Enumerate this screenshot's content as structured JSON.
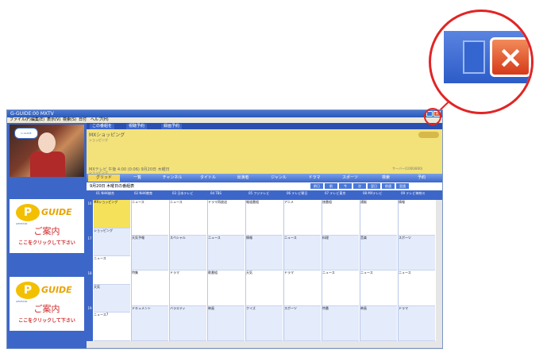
{
  "window": {
    "title": "G-GUIDE:00   MXTV",
    "close_glyph": "×"
  },
  "menu": {
    "items": [
      "ファイル(F)",
      "編集(E)",
      "表示(V)",
      "検索(S)",
      "日付",
      "ヘルプ(H)"
    ]
  },
  "top_tabs": [
    "この番組を",
    "視聴予約",
    "録画予約"
  ],
  "program_info": {
    "title": "MXショッピング",
    "subtitle": "ショッピング",
    "time": "MXテレビ 午後 4:00 (0:06)  9月20日 木曜日",
    "right_text": "サーバー(1000/800)",
    "channel": "ショッピング"
  },
  "toolbar": {
    "buttons": [
      "グリッド",
      "一覧",
      "チャンネル",
      "タイトル",
      "出演者",
      "ジャンル",
      "ドラマ",
      "スポーツ",
      "検索",
      "予約"
    ],
    "active_index": 0
  },
  "date_bar": {
    "text": "9月20日 木曜日の番組表",
    "buttons": [
      "前日",
      "前",
      "今",
      "次",
      "翌日",
      "前週",
      "翌週"
    ]
  },
  "channels": [
    "01 NHK総合",
    "02 NHK教育",
    "03 日本テレビ",
    "04 TBS",
    "05 フジテレビ",
    "06 テレビ朝日",
    "07 テレビ東京",
    "08 MXテレビ",
    "09 テレビ神奈川"
  ],
  "hours": [
    "16",
    "17",
    "18",
    "19"
  ],
  "grid": {
    "columns": [
      [
        "MXショッピング",
        "ショッピング",
        "ニュース",
        "天気",
        "ニュース7"
      ],
      [
        "ニュース",
        "天気予報",
        "特集",
        "ドキュメント"
      ],
      [
        "ニュース",
        "スペシャル",
        "ドラマ",
        "バラエティ"
      ],
      [
        "ドラマ再放送",
        "ニュース",
        "歌番組",
        "映画"
      ],
      [
        "報道番組",
        "情報",
        "天気",
        "クイズ"
      ],
      [
        "アニメ",
        "ニュース",
        "ドラマ",
        "スポーツ"
      ],
      [
        "旅番組",
        "料理",
        "ニュース",
        "特番"
      ],
      [
        "通販",
        "音楽",
        "ニュース",
        "映画"
      ],
      [
        "情報",
        "スポーツ",
        "ニュース",
        "ドラマ"
      ]
    ]
  },
  "ads": [
    {
      "logo": "P",
      "brand": "GUIDE",
      "sub": "GEMSTAR",
      "main": "ご案内",
      "click": "ここをクリックして下さい"
    },
    {
      "logo": "P",
      "brand": "GUIDE",
      "sub": "GEMSTAR",
      "main": "ご案内",
      "click": "ここをクリックして下さい"
    }
  ],
  "thumbnail_badge": "G-GUIDE",
  "zoom_callout": {
    "close_glyph": "×"
  },
  "colors": {
    "accent": "#3d66c9",
    "highlight": "#f5e15a",
    "callout": "#e22424",
    "close": "#d63a18"
  }
}
